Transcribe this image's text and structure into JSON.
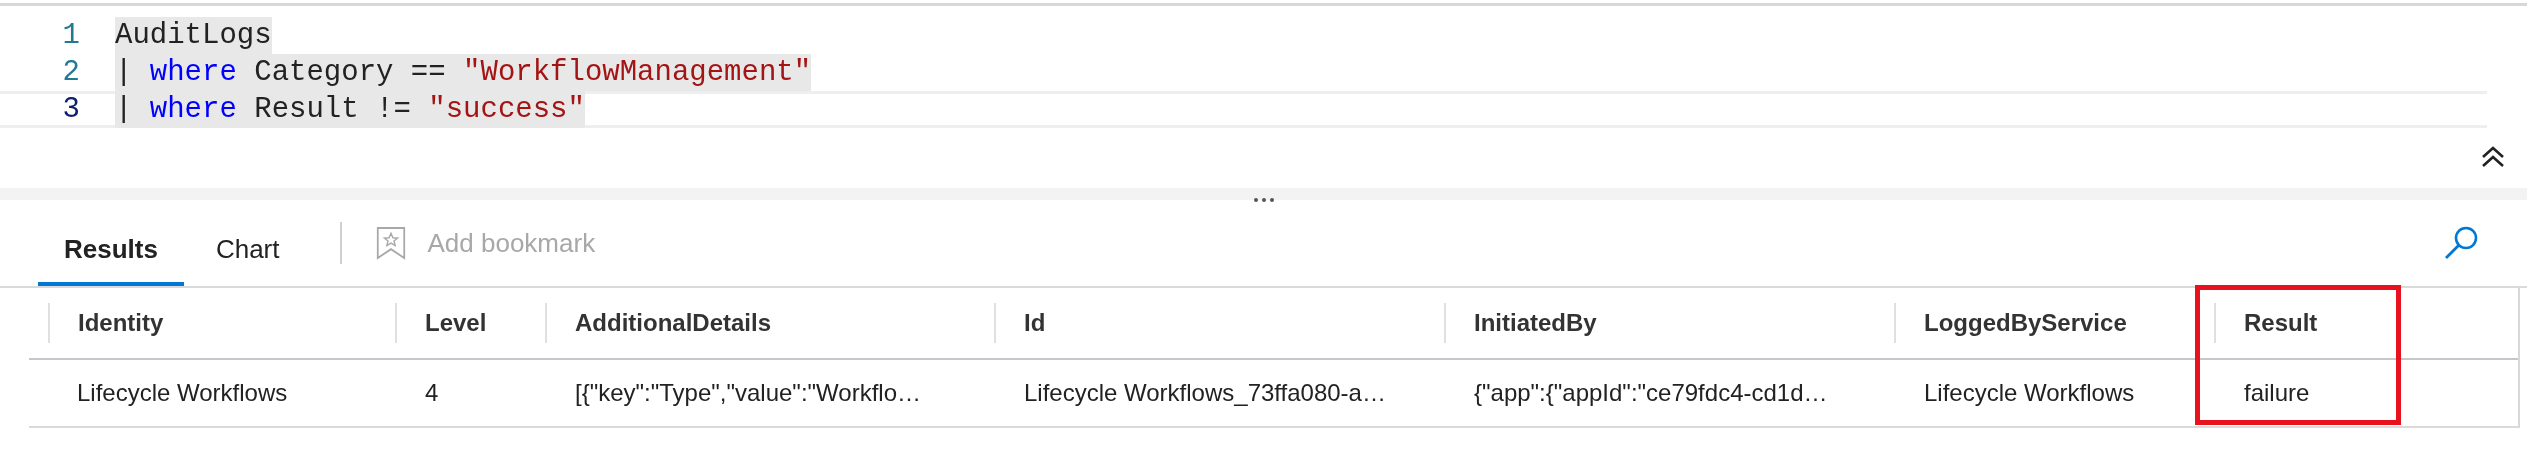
{
  "editor": {
    "lines": [
      {
        "number": "1",
        "active": false,
        "tokens": [
          {
            "kind": "plain",
            "text": "AuditLogs"
          }
        ]
      },
      {
        "number": "2",
        "active": false,
        "tokens": [
          {
            "kind": "plain",
            "text": "| "
          },
          {
            "kind": "keyword",
            "text": "where"
          },
          {
            "kind": "plain",
            "text": " Category == "
          },
          {
            "kind": "string",
            "text": "\"WorkflowManagement\""
          }
        ]
      },
      {
        "number": "3",
        "active": true,
        "tokens": [
          {
            "kind": "plain",
            "text": "| "
          },
          {
            "kind": "keyword",
            "text": "where"
          },
          {
            "kind": "plain",
            "text": " Result != "
          },
          {
            "kind": "string",
            "text": "\"success\""
          }
        ]
      }
    ]
  },
  "tabs": [
    {
      "label": "Results",
      "selected": true
    },
    {
      "label": "Chart",
      "selected": false
    }
  ],
  "toolbar": [
    {
      "label": "Add bookmark",
      "disabled": true
    }
  ],
  "table": {
    "columns": [
      {
        "label": "Identity"
      },
      {
        "label": "Level"
      },
      {
        "label": "AdditionalDetails"
      },
      {
        "label": "Id"
      },
      {
        "label": "InitiatedBy"
      },
      {
        "label": "LoggedByService"
      },
      {
        "label": "Result",
        "highlighted": true
      }
    ],
    "rows": [
      [
        "Lifecycle Workflows",
        "4",
        "[{\"key\":\"Type\",\"value\":\"Workflo…",
        "Lifecycle Workflows_73ffa080-a…",
        "{\"app\":{\"appId\":\"ce79fdc4-cd1d…",
        "Lifecycle Workflows",
        "failure"
      ]
    ]
  }
}
